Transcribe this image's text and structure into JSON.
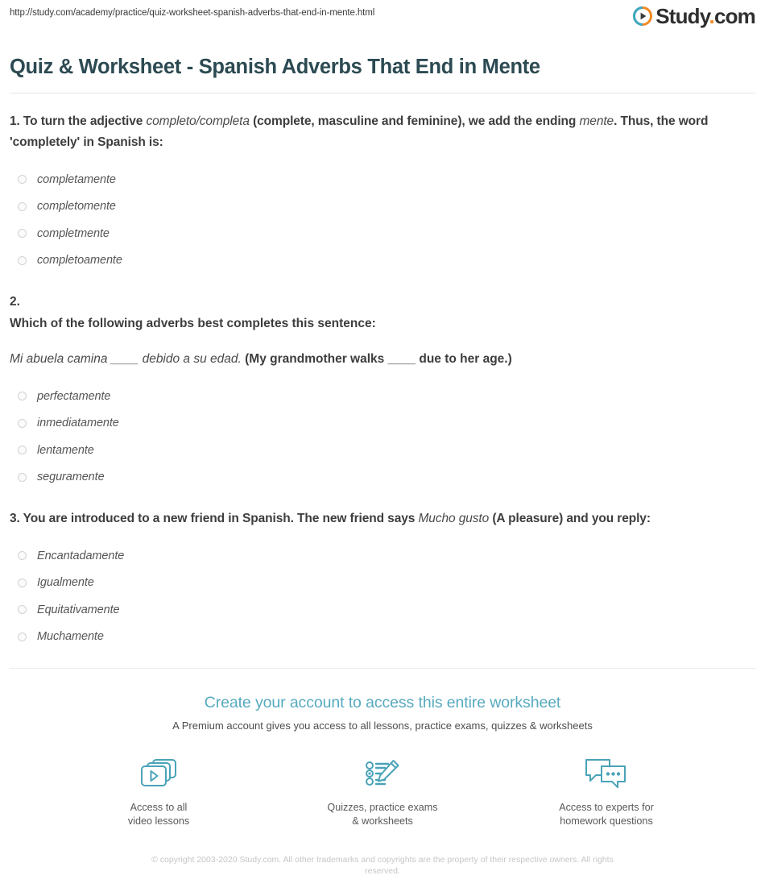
{
  "header": {
    "url": "http://study.com/academy/practice/quiz-worksheet-spanish-adverbs-that-end-in-mente.html",
    "logo_text": "Study",
    "logo_dot": ".",
    "logo_suffix": "com",
    "logo_icon": "play-circle-icon"
  },
  "page_title": "Quiz & Worksheet - Spanish Adverbs That End in Mente",
  "questions": [
    {
      "number": "1.",
      "prefix": "1. To turn the adjective ",
      "italic1": "completo/completa",
      "middle": " (complete, masculine and feminine), we add the ending ",
      "italic2": "mente",
      "suffix": ". Thus, the word 'completely' in Spanish is:",
      "options": [
        "completamente",
        "completomente",
        "completmente",
        "completoamente"
      ]
    },
    {
      "number": "2.",
      "sub_prompt": "Which of the following adverbs best completes this sentence:",
      "sentence_italic1": "Mi abuela camina ____ debido a su edad.",
      "sentence_bold": " (My grandmother walks ____ due to her age.)",
      "options": [
        "perfectamente",
        "inmediatamente",
        "lentamente",
        "seguramente"
      ]
    },
    {
      "number": "3.",
      "prefix": "3. You are introduced to a new friend in Spanish. The new friend says ",
      "italic1": "Mucho gusto",
      "suffix": " (A pleasure) and you reply:",
      "options": [
        "Encantadamente",
        "Igualmente",
        "Equitativamente",
        "Muchamente"
      ]
    }
  ],
  "cta": {
    "title": "Create your account to access this entire worksheet",
    "subtitle": "A Premium account gives you access to all lessons, practice exams, quizzes & worksheets",
    "features": [
      {
        "icon": "video-cards-icon",
        "line1": "Access to all",
        "line2": "video lessons"
      },
      {
        "icon": "quiz-pencil-icon",
        "line1": "Quizzes, practice exams",
        "line2": "& worksheets"
      },
      {
        "icon": "chat-bubbles-icon",
        "line1": "Access to experts for",
        "line2": "homework questions"
      }
    ]
  },
  "footer": {
    "copyright": "© copyright 2003-2020 Study.com. All other trademarks and copyrights are the property of their respective owners. All rights reserved."
  },
  "colors": {
    "title": "#2c4a52",
    "cta_accent": "#57aabf",
    "icon_teal": "#4aa3b8",
    "logo_orange": "#f28a21",
    "text": "#4a4a4a"
  }
}
